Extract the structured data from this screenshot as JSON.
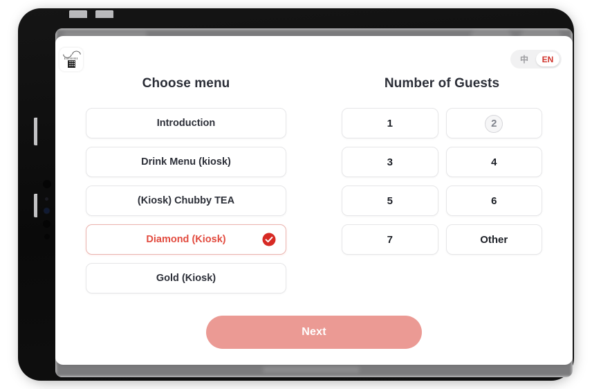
{
  "device": {
    "type": "tablet",
    "frame_color": "#0c0c0c"
  },
  "header": {
    "logo_name": "chubby-tea-logo",
    "language_toggle": {
      "options": [
        {
          "id": "zh",
          "label": "中",
          "active": false
        },
        {
          "id": "en",
          "label": "EN",
          "active": true
        }
      ],
      "active_color": "#d0342c",
      "inactive_color": "#9a9a9e"
    }
  },
  "menu_column": {
    "title": "Choose menu",
    "options": [
      {
        "label": "Introduction",
        "selected": false
      },
      {
        "label": "Drink Menu (kiosk)",
        "selected": false
      },
      {
        "label": "(Kiosk) Chubby TEA",
        "selected": false
      },
      {
        "label": "Diamond (Kiosk)",
        "selected": true
      },
      {
        "label": "Gold (Kiosk)",
        "selected": false
      }
    ],
    "selected_label": "Diamond (Kiosk)",
    "selected_text_color": "#e24b3f",
    "selected_border_color": "#eab3ae",
    "check_icon": "check-circle-icon"
  },
  "guests_column": {
    "title": "Number of Guests",
    "options": [
      {
        "label": "1",
        "pressed": false
      },
      {
        "label": "2",
        "pressed": true
      },
      {
        "label": "3",
        "pressed": false
      },
      {
        "label": "4",
        "pressed": false
      },
      {
        "label": "5",
        "pressed": false
      },
      {
        "label": "6",
        "pressed": false
      },
      {
        "label": "7",
        "pressed": false
      },
      {
        "label": "Other",
        "pressed": false
      }
    ]
  },
  "footer": {
    "next_label": "Next",
    "next_color": "#eb9a94"
  }
}
